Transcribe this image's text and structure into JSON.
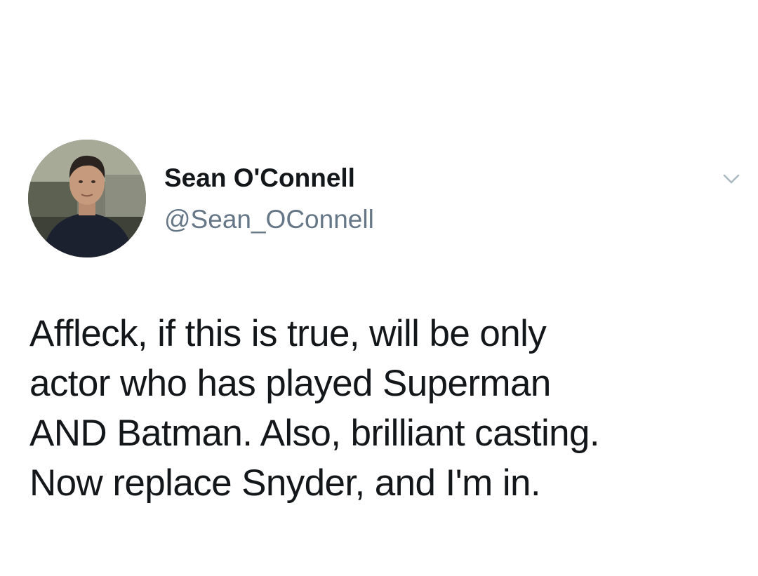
{
  "tweet": {
    "author": {
      "display_name": "Sean O'Connell",
      "handle": "@Sean_OConnell",
      "avatar_icon": "profile-photo"
    },
    "menu_icon": "chevron-down-icon",
    "text_lines": [
      "Affleck, if this is true, will be only",
      "actor who has played Superman",
      "AND Batman. Also, brilliant casting.",
      "Now replace Snyder, and I'm in."
    ]
  },
  "colors": {
    "text_primary": "#14171a",
    "text_secondary": "#657786",
    "caret": "#aab8c2",
    "background": "#ffffff"
  }
}
